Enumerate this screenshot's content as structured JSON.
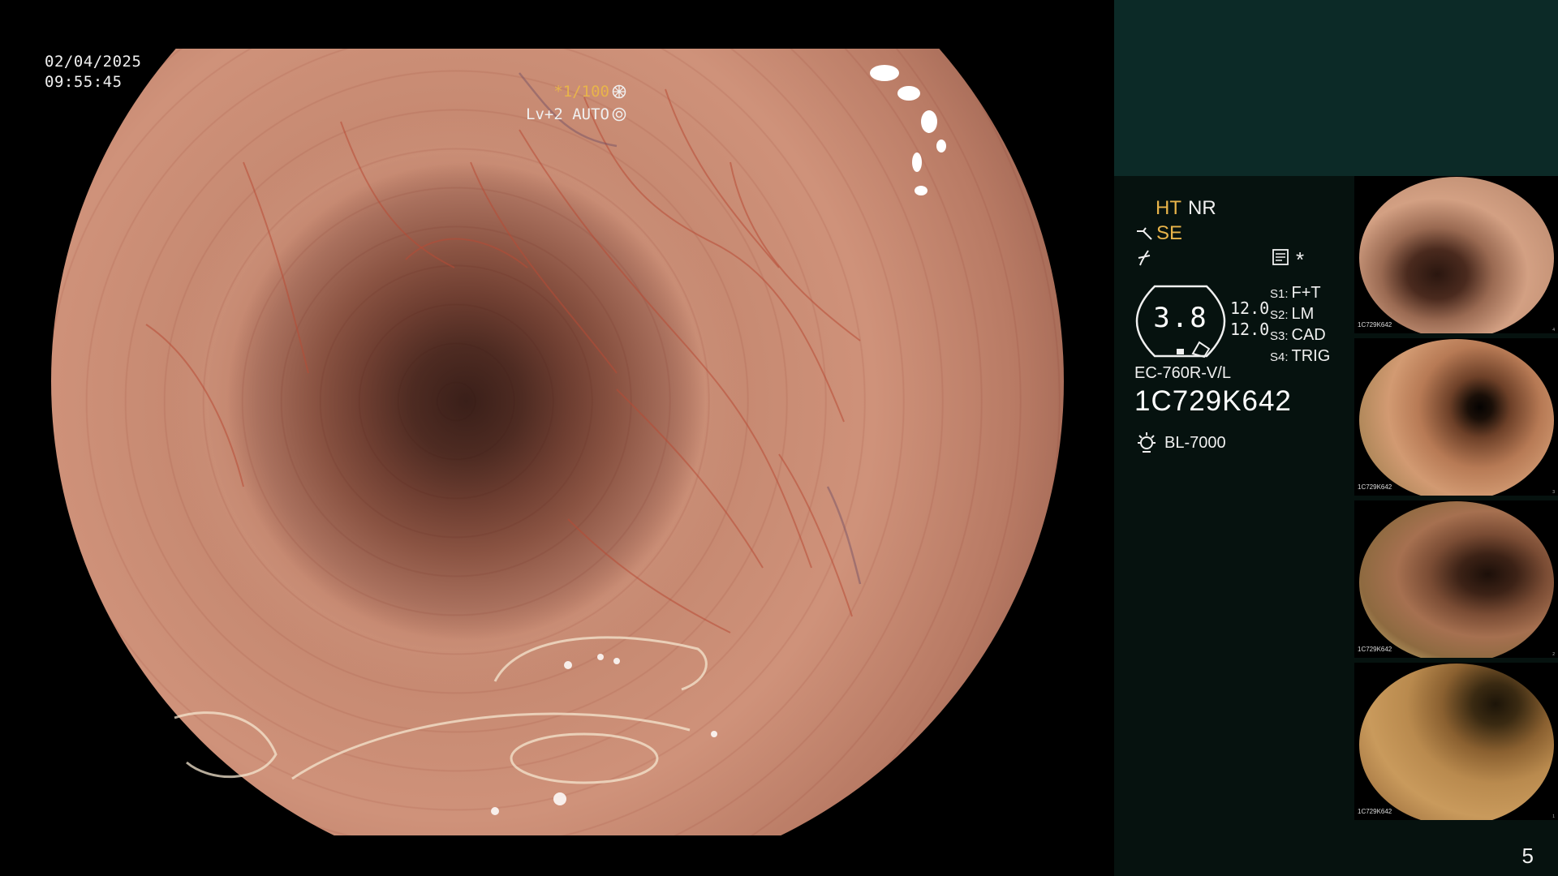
{
  "osd": {
    "date": "02/04/2025",
    "time": "09:55:45",
    "shutter": "*1/100",
    "level": "Lv+2 AUTO"
  },
  "panel": {
    "ht": "HT",
    "nr": "NR",
    "se": "SE",
    "asterisk": "*",
    "badge_value": "3.8",
    "dims": [
      "12.0",
      "12.0"
    ],
    "switches": [
      {
        "key": "S1:",
        "value": "F+T"
      },
      {
        "key": "S2:",
        "value": "LM"
      },
      {
        "key": "S3:",
        "value": "CAD"
      },
      {
        "key": "S4:",
        "value": "TRIG"
      }
    ],
    "scope_model": "EC-760R-V/L",
    "scope_serial": "1C729K642",
    "light_source": "BL-7000"
  },
  "thumbnails": [
    {
      "id": "1C729K642",
      "number": "4"
    },
    {
      "id": "1C729K642",
      "number": "3"
    },
    {
      "id": "1C729K642",
      "number": "2"
    },
    {
      "id": "1C729K642",
      "number": "1"
    }
  ],
  "page_number": "5",
  "colors": {
    "accent": "#e8b44a",
    "panel_top": "#0c2a27",
    "panel_main": "#06120f"
  }
}
